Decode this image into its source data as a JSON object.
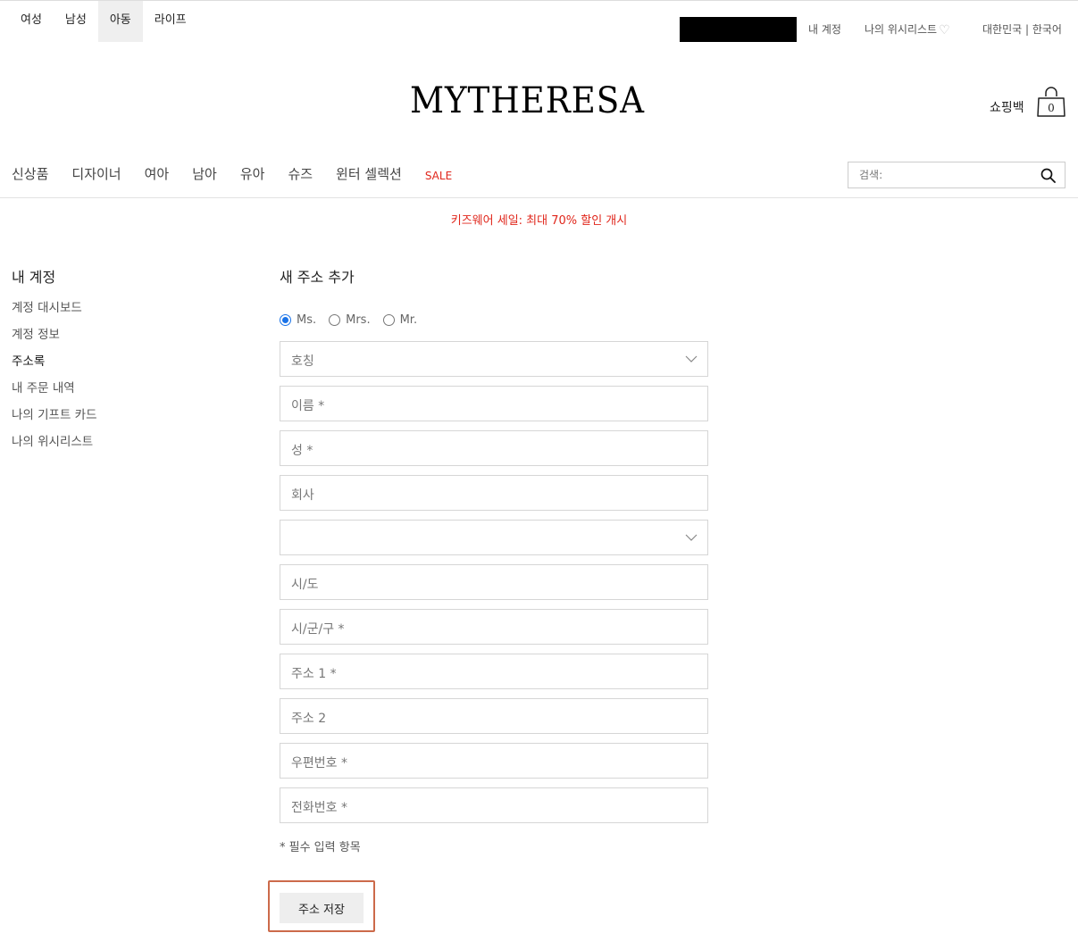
{
  "departments": [
    {
      "label": "여성",
      "active": false
    },
    {
      "label": "남성",
      "active": false
    },
    {
      "label": "아동",
      "active": true
    },
    {
      "label": "라이프",
      "active": false
    }
  ],
  "utility": {
    "account": "내 계정",
    "wishlist": "나의 위시리스트",
    "wishlist_icon": "heart-icon",
    "region": "대한민국 | 한국어"
  },
  "logo": "MYTHERESA",
  "bag": {
    "label": "쇼핑백",
    "count": "0",
    "icon": "shopping-bag-icon"
  },
  "nav": {
    "items": [
      "신상품",
      "디자이너",
      "여아",
      "남아",
      "유아",
      "슈즈",
      "윈터 셀렉션"
    ],
    "sale": "SALE",
    "sale_color": "#e0261b"
  },
  "search": {
    "placeholder": "검색:",
    "icon": "search-icon"
  },
  "promo": "키즈웨어 세일: 최대 70% 할인 개시",
  "sidebar": {
    "title": "내 계정",
    "items": [
      {
        "label": "계정 대시보드",
        "active": false
      },
      {
        "label": "계정 정보",
        "active": false
      },
      {
        "label": "주소록",
        "active": true
      },
      {
        "label": "내 주문 내역",
        "active": false
      },
      {
        "label": "나의 기프트 카드",
        "active": false
      },
      {
        "label": "나의 위시리스트",
        "active": false
      }
    ]
  },
  "form": {
    "title": "새 주소 추가",
    "salutations": [
      {
        "label": "Ms.",
        "checked": true
      },
      {
        "label": "Mrs.",
        "checked": false
      },
      {
        "label": "Mr.",
        "checked": false
      }
    ],
    "fields": [
      {
        "label": "호칭",
        "type": "select"
      },
      {
        "label": "이름 *",
        "type": "text"
      },
      {
        "label": "성 *",
        "type": "text"
      },
      {
        "label": "회사",
        "type": "text"
      },
      {
        "label": "",
        "type": "select"
      },
      {
        "label": "시/도",
        "type": "text"
      },
      {
        "label": "시/군/구 *",
        "type": "text"
      },
      {
        "label": "주소 1 *",
        "type": "text"
      },
      {
        "label": "주소 2",
        "type": "text"
      },
      {
        "label": "우편번호 *",
        "type": "text"
      },
      {
        "label": "전화번호 *",
        "type": "text"
      }
    ],
    "required_note": "* 필수 입력 항목",
    "save_label": "주소 저장"
  }
}
